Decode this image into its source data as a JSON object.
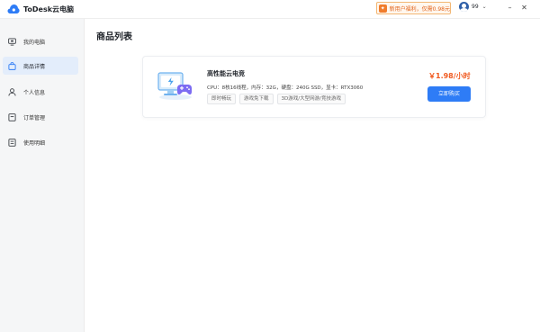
{
  "app": {
    "title": "ToDesk云电脑",
    "accent_color": "#2e7cf6",
    "price_color": "#f0591f"
  },
  "header": {
    "promo_icon": "gift-icon",
    "promo_text": "新用户福利，仅需0.98元",
    "user_name": "99",
    "user_menu_chevron": "chevron-down-icon",
    "window_controls": [
      "minimize-icon",
      "close-icon"
    ]
  },
  "sidebar": {
    "items": [
      {
        "label": "我的电脑",
        "icon": "monitor-icon",
        "active": false
      },
      {
        "label": "商品详情",
        "icon": "shop-bag-icon",
        "active": true
      },
      {
        "label": "个人信息",
        "icon": "person-icon",
        "active": false
      },
      {
        "label": "订单管理",
        "icon": "order-icon",
        "active": false
      },
      {
        "label": "使用明细",
        "icon": "list-icon",
        "active": false
      }
    ]
  },
  "main": {
    "page_title": "商品列表",
    "product": {
      "image_icon": "gaming-pc-icon",
      "name": "高性能云电竞",
      "spec": "CPU：8核16线程，内存：32G，硬盘：240G SSD，显卡：RTX3060",
      "tags": [
        "即时畅玩",
        "游戏免下载",
        "3D游戏/大型网游/竞技游戏"
      ],
      "price": "￥1.98/小时",
      "buy_label": "立即购买"
    }
  }
}
